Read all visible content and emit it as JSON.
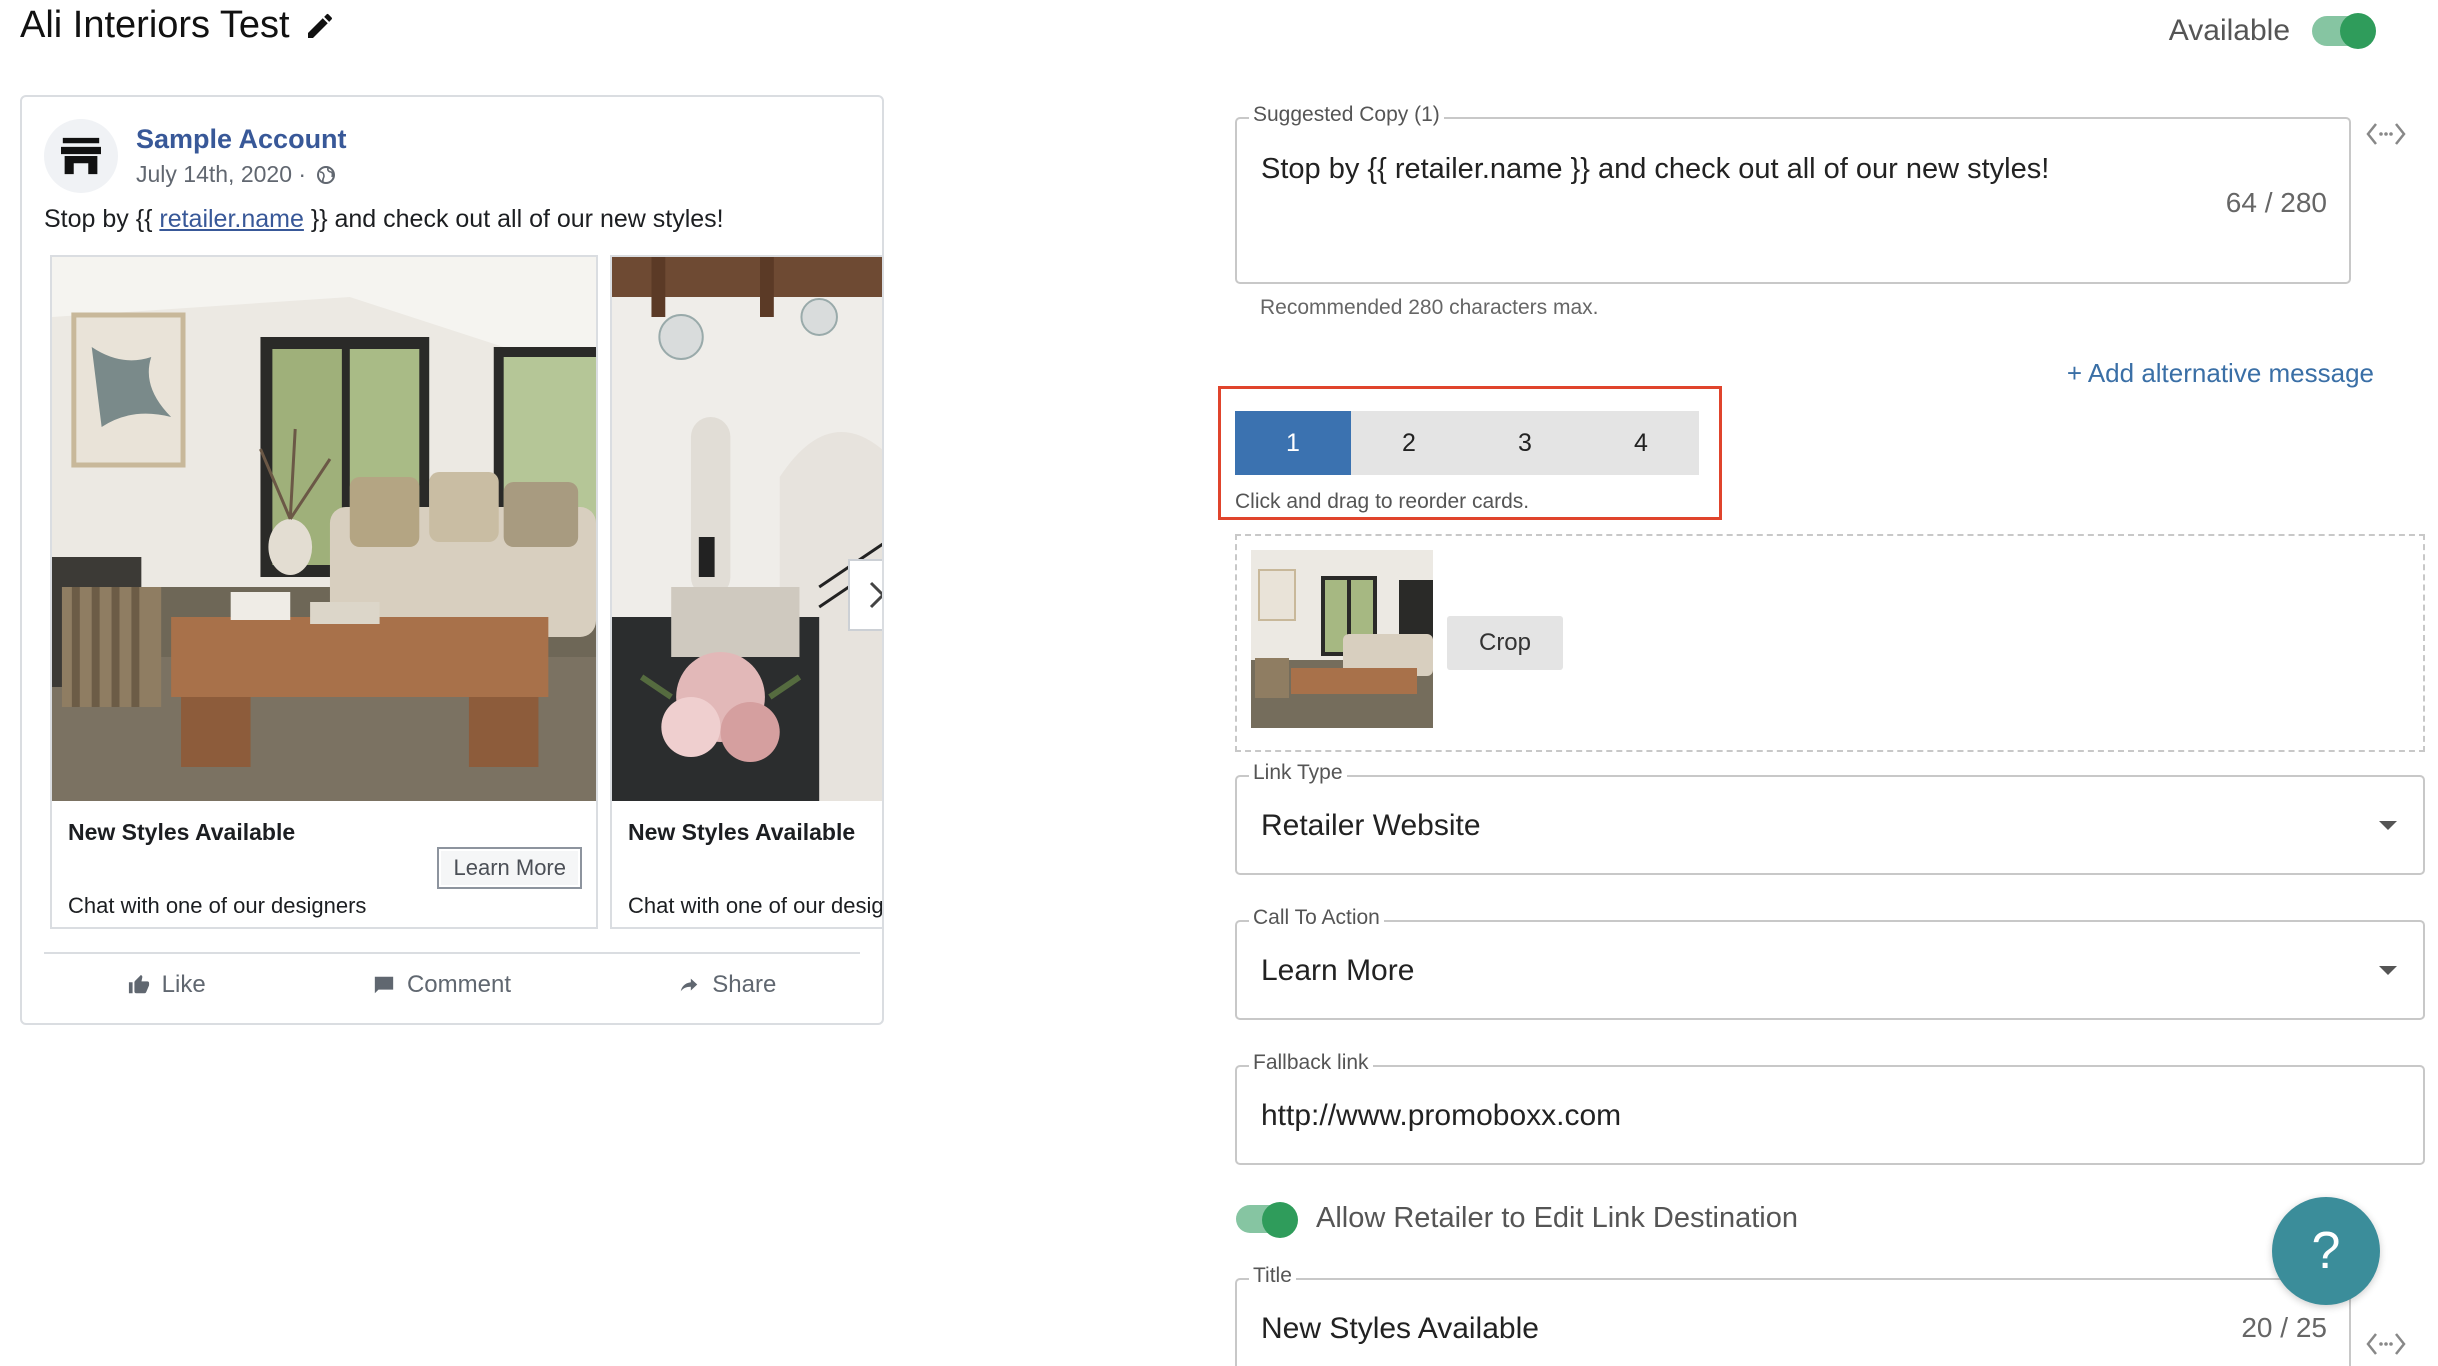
{
  "header": {
    "title": "Ali Interiors Test",
    "available_label": "Available"
  },
  "preview": {
    "account_name": "Sample Account",
    "date": "July 14th, 2020 ·",
    "post_prefix": "Stop by {{ ",
    "post_link": "retailer.name",
    "post_suffix": " }} and check out all of our new styles!",
    "cards": [
      {
        "title": "New Styles Available",
        "description": "Chat with one of our designers",
        "cta": "Learn More"
      },
      {
        "title": "New Styles Available",
        "description": "Chat with one of our designers"
      }
    ],
    "actions": {
      "like": "Like",
      "comment": "Comment",
      "share": "Share"
    }
  },
  "form": {
    "suggested_copy": {
      "label": "Suggested Copy (1)",
      "value": "Stop by {{ retailer.name }} and check out all of our new styles!",
      "counter": "64 / 280",
      "hint": "Recommended 280 characters max."
    },
    "add_alternative": "+ Add alternative message",
    "card_tabs": [
      "1",
      "2",
      "3",
      "4"
    ],
    "reorder_hint": "Click and drag to reorder cards.",
    "crop_label": "Crop",
    "link_type": {
      "label": "Link Type",
      "value": "Retailer Website"
    },
    "call_to_action": {
      "label": "Call To Action",
      "value": "Learn More"
    },
    "fallback_link": {
      "label": "Fallback link",
      "value": "http://www.promoboxx.com"
    },
    "allow_edit_label": "Allow Retailer to Edit Link Destination",
    "title_field": {
      "label": "Title",
      "value": "New Styles Available",
      "counter": "20 / 25"
    },
    "help_label": "?"
  },
  "colors": {
    "accent": "#3b72b0",
    "toggle_on": "#2f9c5b",
    "highlight_border": "#e0442c",
    "help": "#3b8d9a",
    "link": "#385898"
  }
}
